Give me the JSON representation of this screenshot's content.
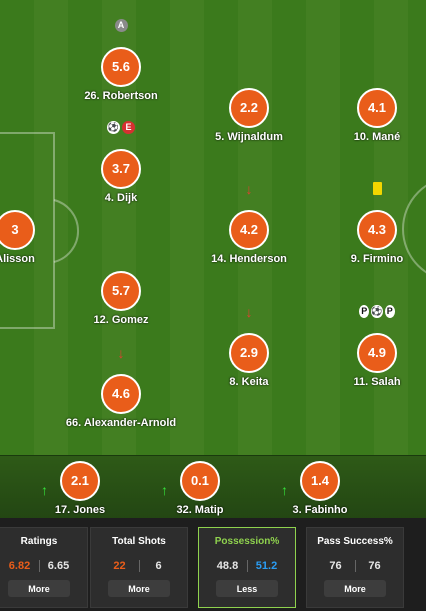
{
  "pitch": {
    "players": [
      {
        "rating": "3",
        "name": "Alisson"
      },
      {
        "rating": "5.6",
        "name": "26. Robertson",
        "icons": [
          {
            "type": "grey",
            "glyph": "A",
            "icon": "captain-badge-icon"
          }
        ]
      },
      {
        "rating": "3.7",
        "name": "4. Dijk",
        "icons": [
          {
            "type": "white",
            "glyph": "⚽",
            "icon": "goal-ball-icon"
          },
          {
            "type": "red",
            "glyph": "E",
            "icon": "error-badge-icon"
          }
        ]
      },
      {
        "rating": "5.7",
        "name": "12. Gomez"
      },
      {
        "rating": "4.6",
        "name": "66. Alexander-Arnold",
        "icons": [
          {
            "type": "arrow-red",
            "glyph": "↓",
            "icon": "subbed-off-arrow-icon"
          }
        ]
      },
      {
        "rating": "2.2",
        "name": "5. Wijnaldum"
      },
      {
        "rating": "4.2",
        "name": "14. Henderson",
        "icons": [
          {
            "type": "arrow-red",
            "glyph": "↓",
            "icon": "subbed-off-arrow-icon"
          }
        ]
      },
      {
        "rating": "2.9",
        "name": "8. Keita",
        "icons": [
          {
            "type": "arrow-red",
            "glyph": "↓",
            "icon": "subbed-off-arrow-icon"
          }
        ]
      },
      {
        "rating": "4.1",
        "name": "10. Mané"
      },
      {
        "rating": "4.3",
        "name": "9. Firmino",
        "icons": [
          {
            "type": "yellow",
            "glyph": "",
            "icon": "yellow-card-icon"
          }
        ]
      },
      {
        "rating": "4.9",
        "name": "11. Salah",
        "icons": [
          {
            "type": "white",
            "glyph": "P",
            "icon": "penalty-icon"
          },
          {
            "type": "white",
            "glyph": "⚽",
            "icon": "goal-ball-icon"
          },
          {
            "type": "white",
            "glyph": "P",
            "icon": "penalty-icon"
          }
        ]
      }
    ]
  },
  "subs": [
    {
      "rating": "2.1",
      "name": "17. Jones",
      "arrow": "↑",
      "arrow_icon": "subbed-on-arrow-icon"
    },
    {
      "rating": "0.1",
      "name": "32. Matip",
      "arrow": "↑",
      "arrow_icon": "subbed-on-arrow-icon"
    },
    {
      "rating": "1.4",
      "name": "3. Fabinho",
      "arrow": "↑",
      "arrow_icon": "subbed-on-arrow-icon"
    }
  ],
  "stats": [
    {
      "title": "Ratings",
      "home": "6.82",
      "away": "6.65",
      "button": "More",
      "active": false,
      "home_style": "orange",
      "away_style": "white"
    },
    {
      "title": "Total Shots",
      "home": "22",
      "away": "6",
      "button": "More",
      "active": false,
      "home_style": "orange",
      "away_style": "white"
    },
    {
      "title": "Possession%",
      "home": "48.8",
      "away": "51.2",
      "button": "Less",
      "active": true,
      "home_style": "white",
      "away_style": "blue"
    },
    {
      "title": "Pass Success%",
      "home": "76",
      "away": "76",
      "button": "More",
      "active": false,
      "home_style": "white",
      "away_style": "white"
    }
  ],
  "colors": {
    "rating_bubble": "#e95d1a",
    "pitch_stripe_a": "#3b7a1c",
    "pitch_stripe_b": "#437f22",
    "active_accent": "#8fd24e",
    "away_blue": "#2a9df4"
  }
}
